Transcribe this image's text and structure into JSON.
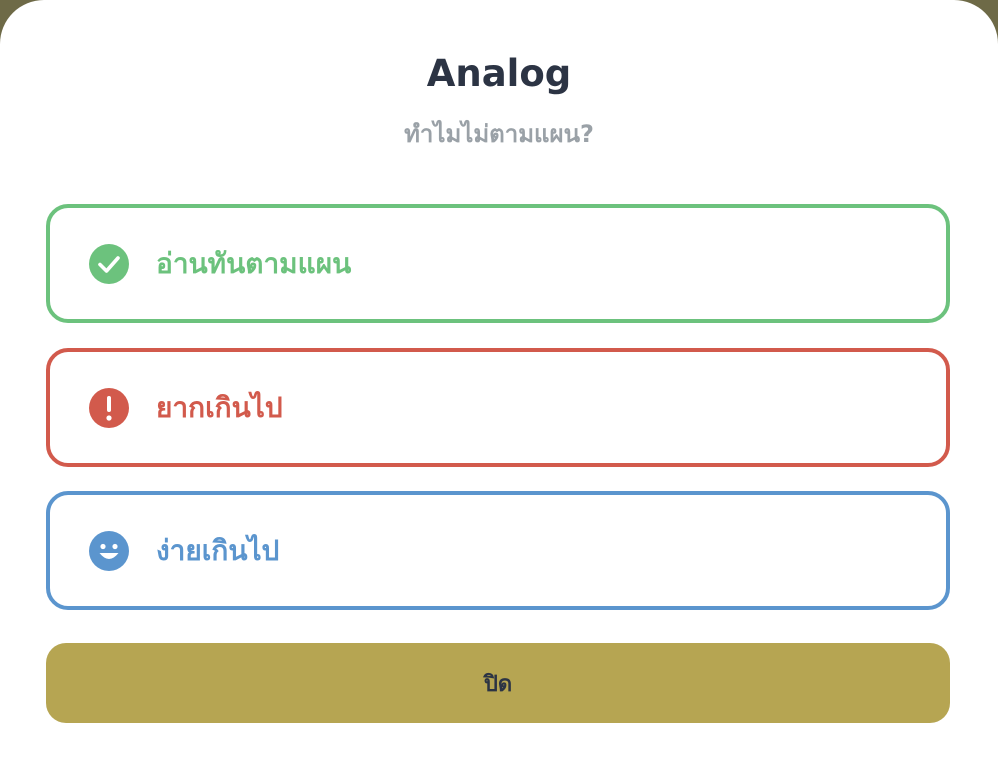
{
  "dialog": {
    "title": "Analog",
    "subtitle": "ทำไมไม่ตามแผน?"
  },
  "options": [
    {
      "id": "ontrack",
      "label": "อ่านทันตามแผน",
      "icon": "check-circle-icon",
      "color": "#6cc27d"
    },
    {
      "id": "hard",
      "label": "ยากเกินไป",
      "icon": "exclamation-circle-icon",
      "color": "#d25a4c"
    },
    {
      "id": "easy",
      "label": "ง่ายเกินไป",
      "icon": "smile-icon",
      "color": "#5b95ce"
    }
  ],
  "close_button": {
    "label": "ปิด",
    "color": "#b6a552"
  }
}
